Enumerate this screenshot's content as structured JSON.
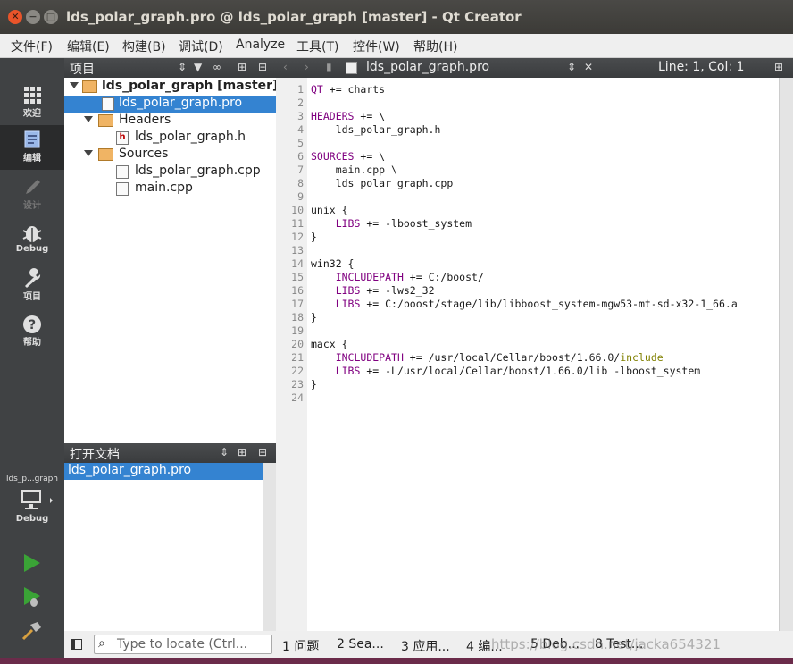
{
  "window": {
    "title": "lds_polar_graph.pro @ lds_polar_graph [master] - Qt Creator",
    "buttons": {
      "close": "✕",
      "minimize": "−",
      "maximize": "□"
    }
  },
  "menu": [
    "文件(F)",
    "编辑(E)",
    "构建(B)",
    "调试(D)",
    "Analyze",
    "工具(T)",
    "控件(W)",
    "帮助(H)"
  ],
  "modes": [
    {
      "label": "欢迎",
      "icon": "grid-icon"
    },
    {
      "label": "编辑",
      "icon": "edit-doc-icon"
    },
    {
      "label": "设计",
      "icon": "pencil-icon"
    },
    {
      "label": "Debug",
      "icon": "bug-icon"
    },
    {
      "label": "项目",
      "icon": "wrench-icon"
    },
    {
      "label": "帮助",
      "icon": "help-icon"
    }
  ],
  "kit": {
    "project": "lds_p...graph",
    "label": "Debug"
  },
  "projects_pane": {
    "title": "项目",
    "tree": {
      "root": "lds_polar_graph [master]",
      "pro_file": "lds_polar_graph.pro",
      "headers": "Headers",
      "header_file": "lds_polar_graph.h",
      "sources": "Sources",
      "source_files": [
        "lds_polar_graph.cpp",
        "main.cpp"
      ]
    }
  },
  "open_docs": {
    "title": "打开文档",
    "items": [
      "lds_polar_graph.pro"
    ]
  },
  "editor": {
    "filename": "lds_polar_graph.pro",
    "position": "Line: 1, Col: 1",
    "line_count": 24
  },
  "code_lines": [
    "QT += charts",
    "",
    "HEADERS += \\",
    "    lds_polar_graph.h",
    "",
    "SOURCES += \\",
    "    main.cpp \\",
    "    lds_polar_graph.cpp",
    "",
    "unix {",
    "    LIBS += -lboost_system",
    "}",
    "",
    "win32 {",
    "    INCLUDEPATH += C:/boost/",
    "    LIBS += -lws2_32",
    "    LIBS += C:/boost/stage/lib/libboost_system-mgw53-mt-sd-x32-1_66.a",
    "}",
    "",
    "macx {",
    "    INCLUDEPATH += /usr/local/Cellar/boost/1.66.0/include",
    "    LIBS += -L/usr/local/Cellar/boost/1.66.0/lib -lboost_system",
    "}",
    ""
  ],
  "statusbar": {
    "locate_placeholder": "Type to locate (Ctrl...",
    "tabs": [
      "1 问题",
      "2 Sea...",
      "3 应用...",
      "4 编...",
      "5 Deb...",
      "8 Test..."
    ],
    "watermark": "https://blog.csdn.net/jacka654321"
  }
}
